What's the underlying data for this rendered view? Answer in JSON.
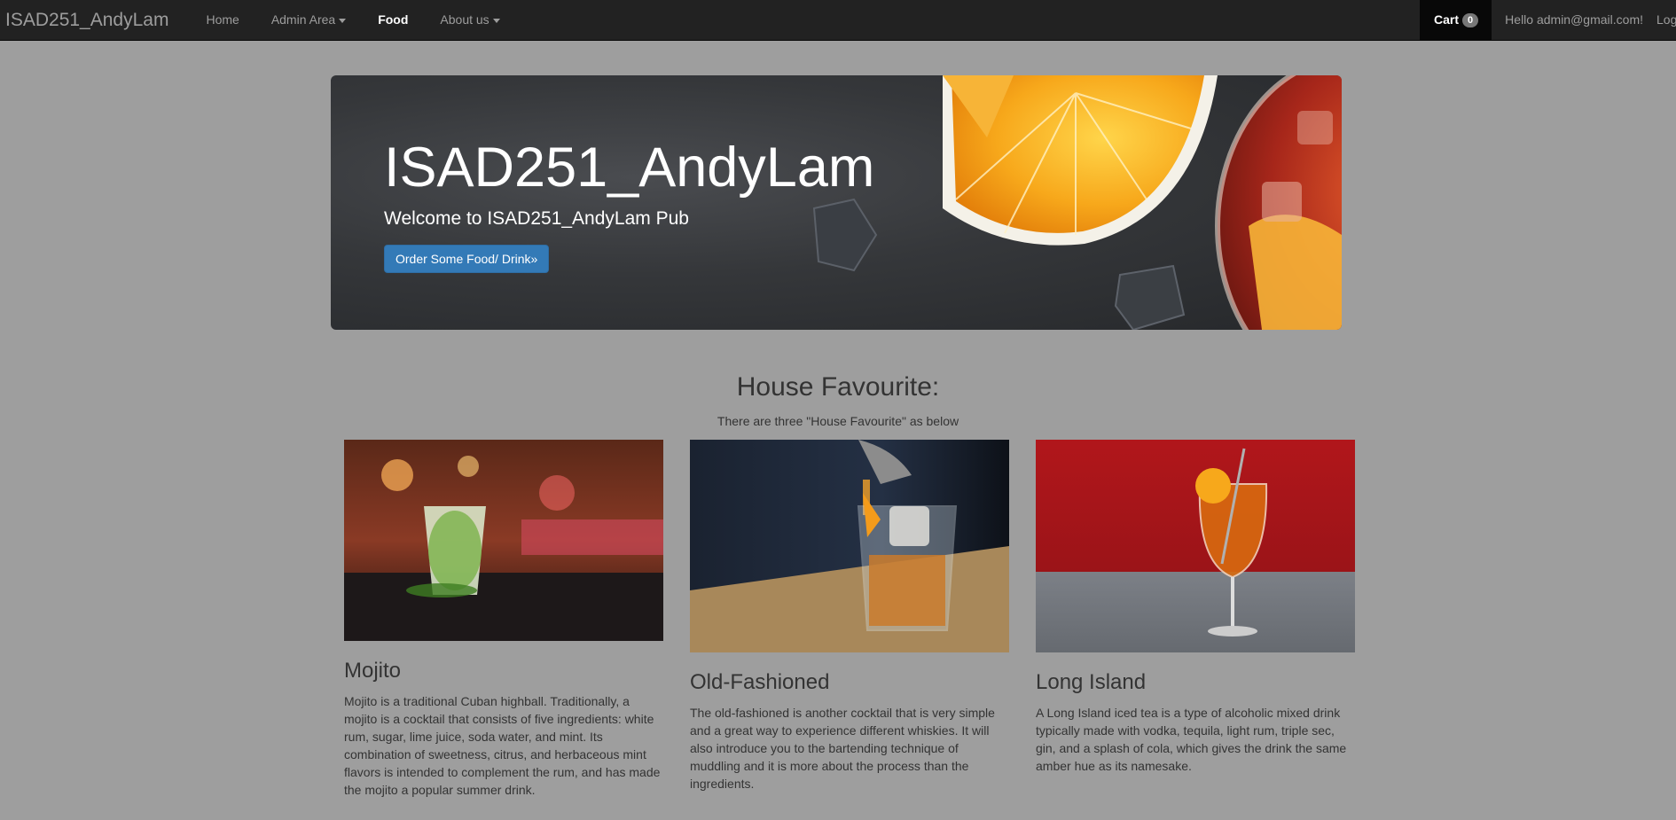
{
  "nav": {
    "brand": "ISAD251_AndyLam",
    "items": [
      {
        "label": "Home"
      },
      {
        "label": "Admin Area"
      },
      {
        "label": "Food"
      },
      {
        "label": "About us"
      }
    ],
    "cart_label": "Cart",
    "cart_count": "0",
    "hello": "Hello admin@gmail.com!",
    "logout": "Log"
  },
  "hero": {
    "title": "ISAD251_AndyLam",
    "subtitle": "Welcome to ISAD251_AndyLam Pub",
    "button": "Order Some Food/ Drink»"
  },
  "favourites": {
    "title": "House Favourite:",
    "subtitle": "There are three \"House Favourite\" as below",
    "items": [
      {
        "name": "Mojito",
        "description": "Mojito is a traditional Cuban highball. Traditionally, a mojito is a cocktail that consists of five ingredients: white rum, sugar, lime juice, soda water, and mint. Its combination of sweetness, citrus, and herbaceous mint flavors is intended to complement the rum, and has made the mojito a popular summer drink."
      },
      {
        "name": "Old-Fashioned",
        "description": "The old-fashioned is another cocktail that is very simple and a great way to experience different whiskies. It will also introduce you to the bartending technique of muddling and it is more about the process than the ingredients."
      },
      {
        "name": "Long Island",
        "description": "A Long Island iced tea is a type of alcoholic mixed drink typically made with vodka, tequila, light rum, triple sec, gin, and a splash of cola, which gives the drink the same amber hue as its namesake."
      }
    ]
  }
}
